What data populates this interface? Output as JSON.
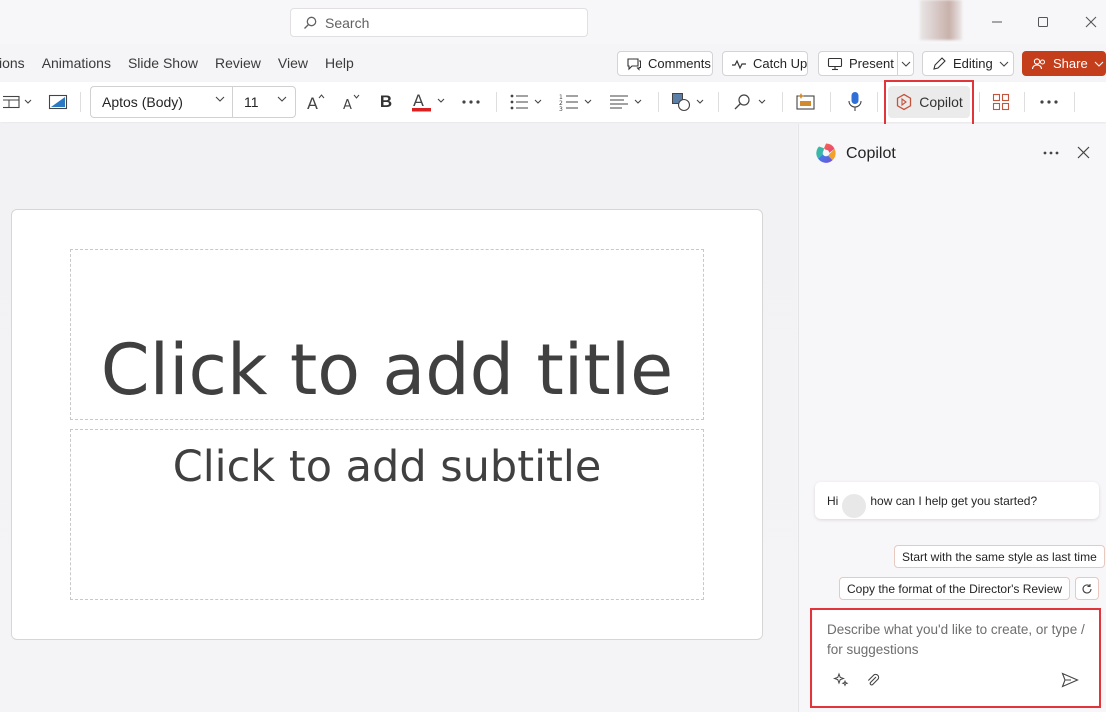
{
  "titlebar": {
    "search_placeholder": "Search"
  },
  "menu": {
    "items": [
      "ions",
      "Animations",
      "Slide Show",
      "Review",
      "View",
      "Help"
    ]
  },
  "actions": {
    "comments": "Comments",
    "catch_up": "Catch Up",
    "present": "Present",
    "editing": "Editing",
    "share": "Share"
  },
  "ribbon": {
    "font_name": "Aptos (Body)",
    "font_size": "11",
    "bold": "B",
    "copilot": "Copilot"
  },
  "slide": {
    "title_placeholder": "Click to add title",
    "subtitle_placeholder": "Click to add subtitle"
  },
  "copilot_pane": {
    "title": "Copilot",
    "greeting_prefix": "Hi",
    "greeting_suffix": "how can I help get you started?",
    "suggestions": [
      "Start with the same style as last time",
      "Copy the format of the Director's Review"
    ],
    "input_placeholder": "Describe what you'd like to create, or type / for suggestions"
  },
  "colors": {
    "accent_red": "#c43e1c",
    "highlight": "#e0353b"
  }
}
